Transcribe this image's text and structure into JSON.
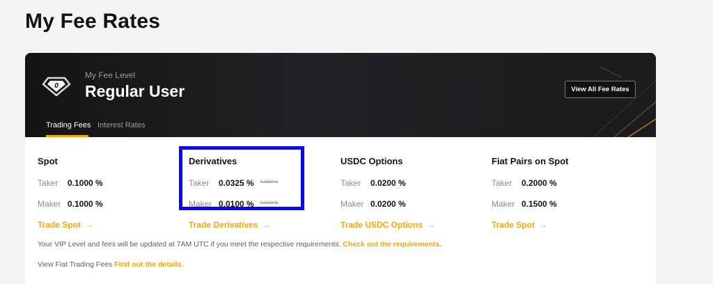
{
  "page": {
    "title": "My Fee Rates"
  },
  "banner": {
    "caption": "My Fee Level",
    "level_name": "Regular User",
    "level_badge": "0",
    "view_all_label": "View All Fee Rates",
    "icon": "diamond-level-icon"
  },
  "tabs": [
    {
      "label": "Trading Fees",
      "active": true
    },
    {
      "label": "Interest Rates",
      "active": false
    }
  ],
  "fees": [
    {
      "title": "Spot",
      "taker_label": "Taker",
      "taker_value": "0.1000 %",
      "taker_original": "",
      "maker_label": "Maker",
      "maker_value": "0.1000 %",
      "maker_original": "",
      "link": "Trade Spot"
    },
    {
      "title": "Derivatives",
      "taker_label": "Taker",
      "taker_value": "0.0325 %",
      "taker_original": "0.0550 %",
      "maker_label": "Maker",
      "maker_value": "0.0100 %",
      "maker_original": "0.0200 %",
      "link": "Trade Derivatives"
    },
    {
      "title": "USDC Options",
      "taker_label": "Taker",
      "taker_value": "0.0200 %",
      "taker_original": "",
      "maker_label": "Maker",
      "maker_value": "0.0200 %",
      "maker_original": "",
      "link": "Trade USDC Options"
    },
    {
      "title": "Fiat Pairs on Spot",
      "taker_label": "Taker",
      "taker_value": "0.2000 %",
      "taker_original": "",
      "maker_label": "Maker",
      "maker_value": "0.1500 %",
      "maker_original": "",
      "link": "Trade Spot"
    }
  ],
  "notes": {
    "vip_text": "Your VIP Level and fees will be updated at 7AM UTC if you meet the respective requirements.",
    "vip_link": "Check out the requirements.",
    "fiat_text": "View Fiat Trading Fees",
    "fiat_link": "Find out the details."
  },
  "colors": {
    "accent": "#f7a600",
    "highlight_box": "#0a0ae6",
    "banner_bg": "#1a1a1c"
  }
}
